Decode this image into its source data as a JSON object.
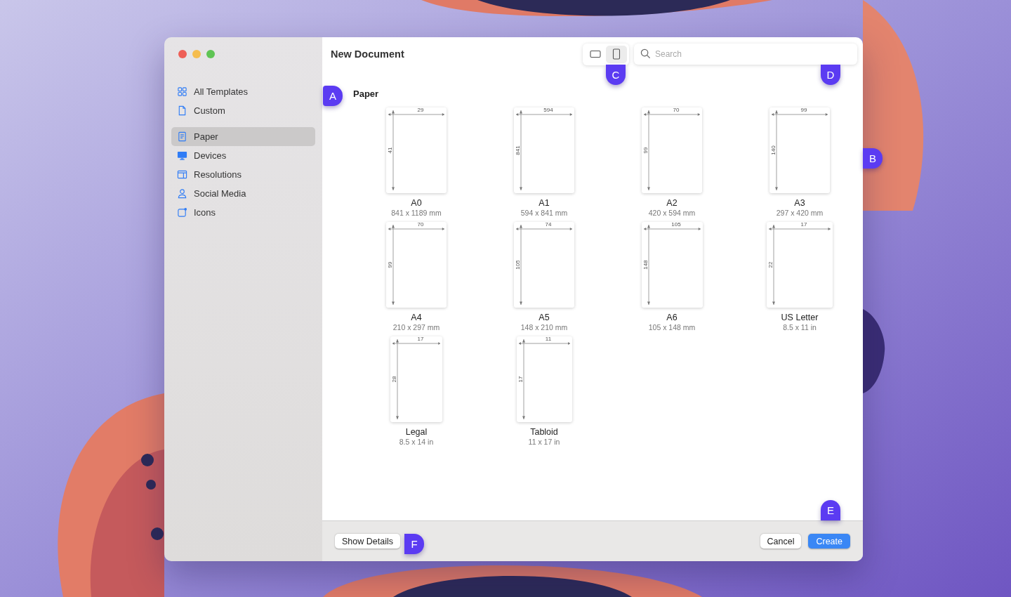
{
  "window": {
    "title": "New Document"
  },
  "sidebar": {
    "groups": [
      [
        {
          "label": "All Templates",
          "selected": false
        },
        {
          "label": "Custom",
          "selected": false
        }
      ],
      [
        {
          "label": "Paper",
          "selected": true
        },
        {
          "label": "Devices",
          "selected": false
        },
        {
          "label": "Resolutions",
          "selected": false
        },
        {
          "label": "Social Media",
          "selected": false
        },
        {
          "label": "Icons",
          "selected": false
        }
      ]
    ]
  },
  "view_toggle": [
    {
      "kind": "landscape",
      "selected": false
    },
    {
      "kind": "portrait",
      "selected": true
    }
  ],
  "search": {
    "placeholder": "Search"
  },
  "section_title": "Paper",
  "templates": [
    {
      "name": "A0",
      "size": "841 x 1189 mm",
      "width_label": "29",
      "height_label": "41"
    },
    {
      "name": "A1",
      "size": "594 x 841 mm",
      "width_label": "594",
      "height_label": "841"
    },
    {
      "name": "A2",
      "size": "420 x 594 mm",
      "width_label": "70",
      "height_label": "99"
    },
    {
      "name": "A3",
      "size": "297 x 420 mm",
      "width_label": "99",
      "height_label": "140"
    },
    {
      "name": "A4",
      "size": "210 x 297 mm",
      "width_label": "70",
      "height_label": "99"
    },
    {
      "name": "A5",
      "size": "148 x 210 mm",
      "width_label": "74",
      "height_label": "105"
    },
    {
      "name": "A6",
      "size": "105 x 148 mm",
      "width_label": "105",
      "height_label": "148"
    },
    {
      "name": "US Letter",
      "size": "8.5 x 11 in",
      "width_label": "17",
      "height_label": "22"
    },
    {
      "name": "Legal",
      "size": "8.5 x 14 in",
      "width_label": "17",
      "height_label": "28"
    },
    {
      "name": "Tabloid",
      "size": "11 x 17 in",
      "width_label": "11",
      "height_label": "17"
    }
  ],
  "footer": {
    "details_button": "Show Details",
    "cancel_button": "Cancel",
    "create_button": "Create"
  },
  "callouts": [
    {
      "letter": "A",
      "kind": "left"
    },
    {
      "letter": "B",
      "kind": "right"
    },
    {
      "letter": "C",
      "kind": "down"
    },
    {
      "letter": "D",
      "kind": "down"
    },
    {
      "letter": "E",
      "kind": "up"
    },
    {
      "letter": "F",
      "kind": "right"
    }
  ]
}
